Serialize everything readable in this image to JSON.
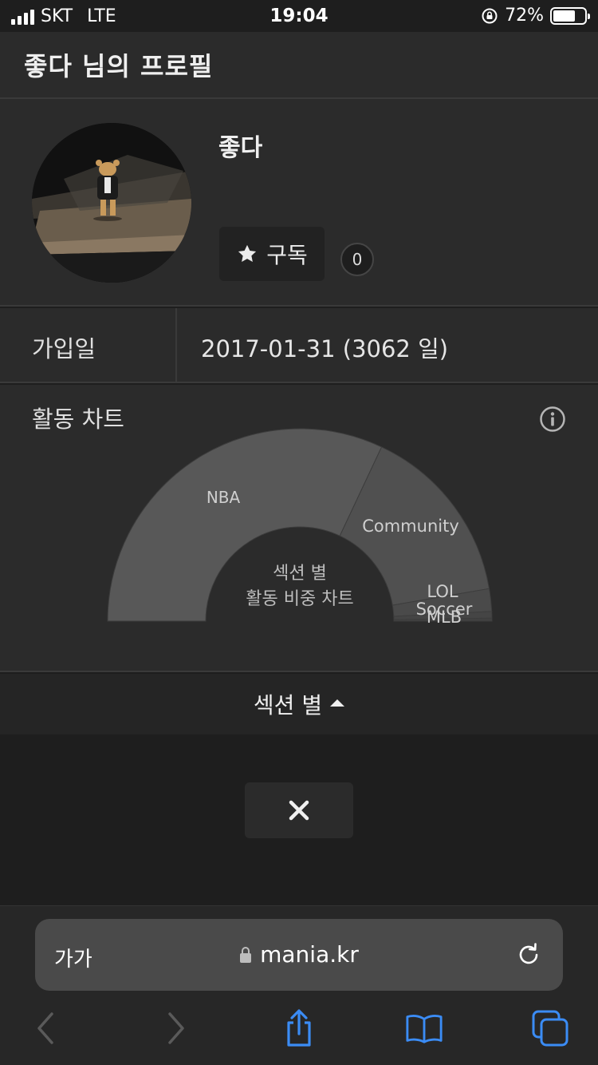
{
  "status_bar": {
    "carrier": "SKT",
    "network": "LTE",
    "time": "19:04",
    "battery": "72%",
    "battery_level": 0.72,
    "icons": [
      "signal-icon",
      "orientation-lock-icon",
      "battery-icon"
    ]
  },
  "header": {
    "title": "좋다 님의 프로필"
  },
  "profile": {
    "username": "좋다",
    "subscribe_label": "구독",
    "subscriber_count": "0"
  },
  "join": {
    "label": "가입일",
    "value": "2017-01-31 (3062 일)"
  },
  "activity": {
    "title": "활동 차트",
    "center_line1": "섹션 별",
    "center_line2": "활동 비중 차트"
  },
  "chart_data": {
    "type": "pie",
    "shape": "half-donut",
    "title": "활동 차트",
    "center_label": [
      "섹션 별",
      "활동 비중 차트"
    ],
    "slices": [
      {
        "label": "NBA",
        "value": 64.0,
        "color": "#585858"
      },
      {
        "label": "Community",
        "value": 30.6,
        "color": "#505050"
      },
      {
        "label": "LOL",
        "value": 3.8,
        "color": "#4a4a4a"
      },
      {
        "label": "Soccer",
        "value": 1.1,
        "color": "#454545"
      },
      {
        "label": "MLB",
        "value": 0.5,
        "color": "#414141"
      }
    ]
  },
  "section_toggle": {
    "label": "섹션 별"
  },
  "browser": {
    "text_size_label": "가가",
    "url": "mania.kr"
  },
  "colors": {
    "background": "#1e1e1e",
    "panel": "#2b2b2b",
    "accent_blue": "#3b8cf5"
  }
}
